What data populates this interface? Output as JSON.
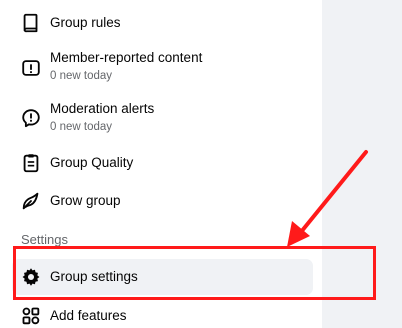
{
  "sidebar": {
    "items": [
      {
        "label": "Group rules",
        "icon": "book-icon"
      },
      {
        "label": "Member-reported content",
        "subtext": "0 new today",
        "icon": "report-icon"
      },
      {
        "label": "Moderation alerts",
        "subtext": "0 new today",
        "icon": "alert-speech-icon"
      },
      {
        "label": "Group Quality",
        "icon": "clipboard-icon"
      },
      {
        "label": "Grow group",
        "icon": "grow-icon"
      }
    ],
    "settings_section": {
      "title": "Settings",
      "items": [
        {
          "label": "Group settings",
          "icon": "gear-icon",
          "selected": true
        },
        {
          "label": "Add features",
          "icon": "features-grid-icon"
        }
      ]
    }
  },
  "annotation": {
    "color": "#ff1a1a",
    "target": "Group settings"
  }
}
